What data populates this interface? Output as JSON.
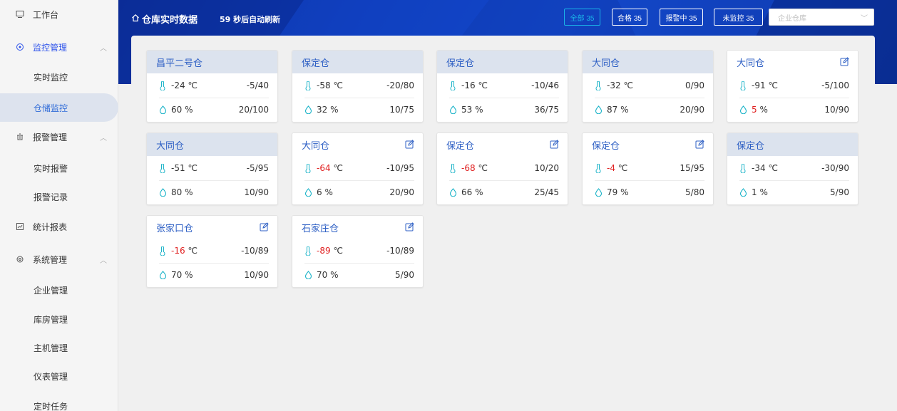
{
  "sidebar": {
    "items": [
      {
        "label": "工作台",
        "icon": "monitor-icon"
      },
      {
        "label": "监控管理",
        "icon": "target-icon"
      },
      {
        "label": "实时监控"
      },
      {
        "label": "仓储监控"
      },
      {
        "label": "报警管理",
        "icon": "alarm-icon"
      },
      {
        "label": "实时报警"
      },
      {
        "label": "报警记录"
      },
      {
        "label": "统计报表",
        "icon": "report-icon"
      },
      {
        "label": "系统管理",
        "icon": "settings-icon"
      },
      {
        "label": "企业管理"
      },
      {
        "label": "库房管理"
      },
      {
        "label": "主机管理"
      },
      {
        "label": "仪表管理"
      },
      {
        "label": "定时任务"
      }
    ]
  },
  "header": {
    "title": "仓库实时数据",
    "refresh": "59 秒后自动刷新",
    "filters": [
      {
        "label": "全部 35"
      },
      {
        "label": "合格 35"
      },
      {
        "label": "报警中 35"
      },
      {
        "label": "未监控 35"
      }
    ],
    "select_placeholder": "企业仓库"
  },
  "colors": {
    "accent": "#2d5fc4",
    "alarm": "#e02020",
    "header_bg": "#0d3ab5",
    "active_filter": "#1ab3e8"
  },
  "cards": [
    {
      "name": "昌平二号仓",
      "temp": "-24",
      "temp_unit": "℃",
      "temp_range": "-5/40",
      "hum": "60",
      "hum_unit": "%",
      "hum_range": "20/100"
    },
    {
      "name": "保定仓",
      "temp": "-58",
      "temp_unit": "℃",
      "temp_range": "-20/80",
      "hum": "32",
      "hum_unit": "%",
      "hum_range": "10/75"
    },
    {
      "name": "保定仓",
      "temp": "-16",
      "temp_unit": "℃",
      "temp_range": "-10/46",
      "hum": "53",
      "hum_unit": "%",
      "hum_range": "36/75"
    },
    {
      "name": "大同仓",
      "temp": "-32",
      "temp_unit": "℃",
      "temp_range": "0/90",
      "hum": "87",
      "hum_unit": "%",
      "hum_range": "20/90"
    },
    {
      "name": "大同仓",
      "temp": "-91",
      "temp_unit": "℃",
      "temp_range": "-5/100",
      "hum": "5",
      "hum_unit": "%",
      "hum_range": "10/90"
    },
    {
      "name": "大同仓",
      "temp": "-51",
      "temp_unit": "℃",
      "temp_range": "-5/95",
      "hum": "80",
      "hum_unit": "%",
      "hum_range": "10/90"
    },
    {
      "name": "大同仓",
      "temp": "-64",
      "temp_unit": "℃",
      "temp_range": "-10/95",
      "hum": "6",
      "hum_unit": "%",
      "hum_range": "20/90"
    },
    {
      "name": "保定仓",
      "temp": "-68",
      "temp_unit": "℃",
      "temp_range": "10/20",
      "hum": "66",
      "hum_unit": "%",
      "hum_range": "25/45"
    },
    {
      "name": "保定仓",
      "temp": "-4",
      "temp_unit": "℃",
      "temp_range": "15/95",
      "hum": "79",
      "hum_unit": "%",
      "hum_range": "5/80"
    },
    {
      "name": "保定仓",
      "temp": "-34",
      "temp_unit": "℃",
      "temp_range": "-30/90",
      "hum": "1",
      "hum_unit": "%",
      "hum_range": "5/90"
    },
    {
      "name": "张家口仓",
      "temp": "-16",
      "temp_unit": "℃",
      "temp_range": "-10/89",
      "hum": "70",
      "hum_unit": "%",
      "hum_range": "10/90"
    },
    {
      "name": "石家庄仓",
      "temp": "-89",
      "temp_unit": "℃",
      "temp_range": "-10/89",
      "hum": "70",
      "hum_unit": "%",
      "hum_range": "5/90"
    }
  ]
}
